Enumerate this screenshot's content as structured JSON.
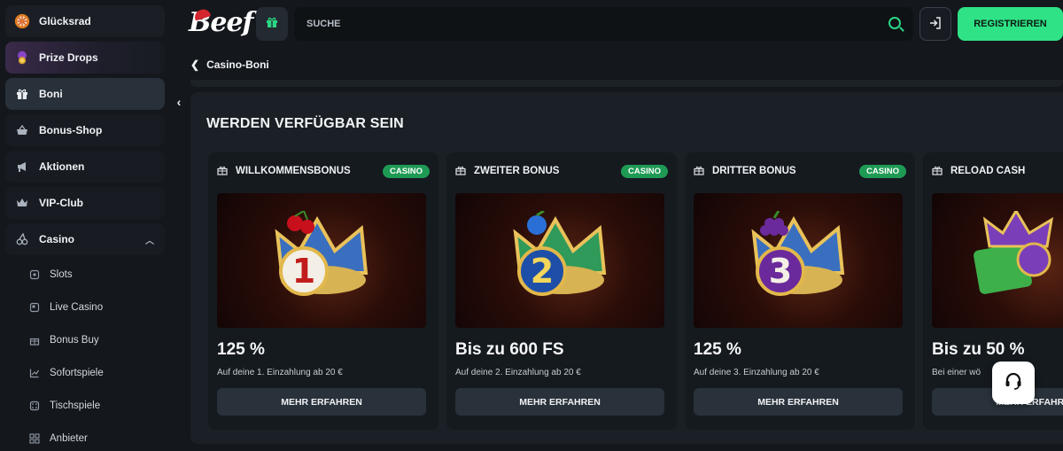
{
  "sidebar": {
    "items": [
      {
        "label": "Glücksrad",
        "icon": "wheel-icon"
      },
      {
        "label": "Prize Drops",
        "icon": "coin-icon"
      },
      {
        "label": "Boni",
        "icon": "gift-icon"
      },
      {
        "label": "Bonus-Shop",
        "icon": "basket-icon"
      },
      {
        "label": "Aktionen",
        "icon": "megaphone-icon"
      },
      {
        "label": "VIP-Club",
        "icon": "crown-icon"
      },
      {
        "label": "Casino",
        "icon": "cherry-icon"
      }
    ],
    "casino_sub": [
      {
        "label": "Slots",
        "icon": "slot-icon"
      },
      {
        "label": "Live Casino",
        "icon": "live-icon"
      },
      {
        "label": "Bonus Buy",
        "icon": "gift-icon"
      },
      {
        "label": "Sofortspiele",
        "icon": "chart-icon"
      },
      {
        "label": "Tischspiele",
        "icon": "dice-icon"
      },
      {
        "label": "Anbieter",
        "icon": "grid-icon"
      }
    ]
  },
  "header": {
    "logo": "Beef",
    "search_placeholder": "SUCHE",
    "register_label": "REGISTRIEREN"
  },
  "breadcrumb": {
    "label": "Casino-Boni"
  },
  "section": {
    "title": "WERDEN VERFÜGBAR SEIN"
  },
  "cards": [
    {
      "name": "WILLKOMMENSBONUS",
      "badge": "CASINO",
      "value": "125 %",
      "desc": "Auf deine 1. Einzahlung ab 20 €",
      "button": "MEHR ERFAHREN",
      "number": "1",
      "fruit_color": "#c8101c"
    },
    {
      "name": "ZWEITER BONUS",
      "badge": "CASINO",
      "value": "Bis zu 600 FS",
      "desc": "Auf deine 2. Einzahlung ab 20 €",
      "button": "MEHR ERFAHREN",
      "number": "2",
      "fruit_color": "#2a6fd6"
    },
    {
      "name": "DRITTER BONUS",
      "badge": "CASINO",
      "value": "125 %",
      "desc": "Auf deine 3. Einzahlung ab 20 €",
      "button": "MEHR ERFAHREN",
      "number": "3",
      "fruit_color": "#6b2a9c"
    },
    {
      "name": "RELOAD CASH",
      "badge": "",
      "value": "Bis zu 50 %",
      "desc": "Bei einer wö",
      "button": "MEHR ERFAHREN",
      "number": "",
      "fruit_color": "#3db04a"
    }
  ],
  "colors": {
    "accent": "#2ee285",
    "badge": "#1f9a55"
  }
}
